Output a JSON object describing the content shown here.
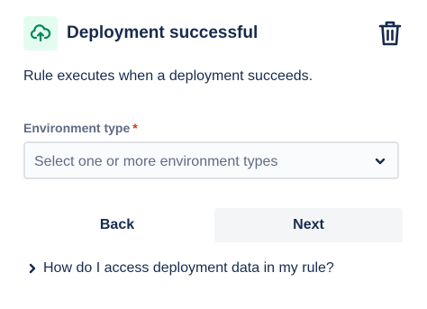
{
  "header": {
    "title": "Deployment successful",
    "trigger_icon": "cloud-upload-icon",
    "delete_icon": "trash-icon"
  },
  "description": "Rule executes when a deployment succeeds.",
  "environment_field": {
    "label": "Environment type",
    "required_marker": "*",
    "placeholder": "Select one or more environment types",
    "dropdown_icon": "chevron-down-icon"
  },
  "actions": {
    "back_label": "Back",
    "next_label": "Next"
  },
  "help": {
    "question": "How do I access deployment data in my rule?",
    "expand_icon": "chevron-right-icon"
  },
  "colors": {
    "icon_background": "#E3FCEF",
    "icon_green": "#00875A",
    "text_primary": "#172B4D",
    "text_subtle": "#5E6C84",
    "required": "#DE350B",
    "next_button_bg": "#F4F5F7"
  }
}
